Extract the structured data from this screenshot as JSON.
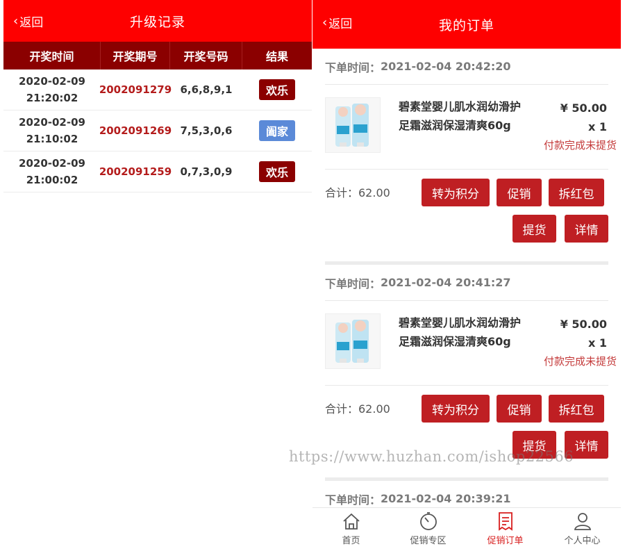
{
  "left": {
    "back_label": "返回",
    "title": "升级记录",
    "columns": [
      "开奖时间",
      "开奖期号",
      "开奖号码",
      "结果"
    ],
    "rows": [
      {
        "date": "2020-02-09",
        "time": "21:20:02",
        "period": "2002091279",
        "numbers": "6,6,8,9,1",
        "result": "欢乐",
        "result_color": "#8b0000"
      },
      {
        "date": "2020-02-09",
        "time": "21:10:02",
        "period": "2002091269",
        "numbers": "7,5,3,0,6",
        "result": "阖家",
        "result_color": "#5b8ad8"
      },
      {
        "date": "2020-02-09",
        "time": "21:00:02",
        "period": "2002091259",
        "numbers": "0,7,3,0,9",
        "result": "欢乐",
        "result_color": "#8b0000"
      }
    ]
  },
  "right": {
    "back_label": "返回",
    "title": "我的订单",
    "orders": [
      {
        "time_label": "下单时间：",
        "time": "2021-02-04 20:42:20",
        "product_name": "碧素堂婴儿肌水润幼滑护足霜滋润保湿清爽60g",
        "price": "¥ 50.00",
        "qty": "x 1",
        "status": "付款完成未提货",
        "total": "合计：62.00",
        "buttons": [
          "转为积分",
          "促销",
          "拆红包",
          "提货",
          "详情"
        ]
      },
      {
        "time_label": "下单时间：",
        "time": "2021-02-04 20:41:27",
        "product_name": "碧素堂婴儿肌水润幼滑护足霜滋润保湿清爽60g",
        "price": "¥ 50.00",
        "qty": "x 1",
        "status": "付款完成未提货",
        "total": "合计：62.00",
        "buttons": [
          "转为积分",
          "促销",
          "拆红包",
          "提货",
          "详情"
        ]
      },
      {
        "time_label": "下单时间：",
        "time": "2021-02-04 20:39:21"
      }
    ],
    "watermark": "https://www.huzhan.com/ishop22566",
    "nav": [
      {
        "label": "首页",
        "icon": "home-icon"
      },
      {
        "label": "促销专区",
        "icon": "timer-icon"
      },
      {
        "label": "促销订单",
        "icon": "order-icon"
      },
      {
        "label": "个人中心",
        "icon": "user-icon"
      }
    ],
    "accent": "#fe0000"
  }
}
